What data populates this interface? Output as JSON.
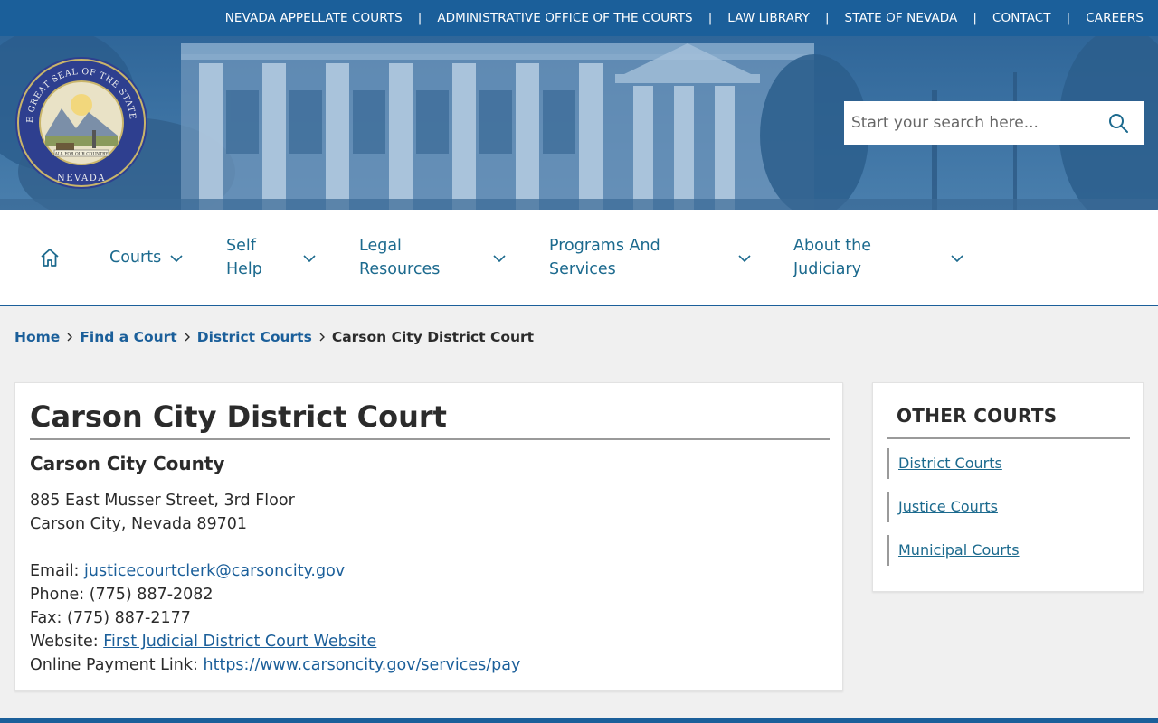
{
  "top_links": [
    {
      "label": "NEVADA APPELLATE COURTS"
    },
    {
      "label": "ADMINISTRATIVE OFFICE OF THE COURTS"
    },
    {
      "label": "LAW LIBRARY"
    },
    {
      "label": "STATE OF NEVADA"
    },
    {
      "label": "CONTACT"
    },
    {
      "label": "CAREERS"
    }
  ],
  "top_separator": "|",
  "seal": {
    "ring_text": "THE GREAT SEAL OF THE STATE OF",
    "bottom_text": "NEVADA",
    "motto": "ALL FOR OUR COUNTRY",
    "icon": "state-seal"
  },
  "search": {
    "placeholder": "Start your search here...",
    "icon": "search-icon"
  },
  "nav": {
    "home_icon": "home-icon",
    "items": [
      {
        "label": "Courts"
      },
      {
        "line1": "Self",
        "line2": "Help"
      },
      {
        "line1": "Legal",
        "line2": "Resources"
      },
      {
        "line1": "Programs And",
        "line2": "Services"
      },
      {
        "line1": "About the",
        "line2": "Judiciary"
      }
    ]
  },
  "breadcrumb": {
    "links": [
      "Home",
      "Find a Court",
      "District Courts"
    ],
    "current": "Carson City District Court"
  },
  "court": {
    "title": "Carson City District Court",
    "county": "Carson City County",
    "address_line1": "885 East Musser Street, 3rd Floor",
    "address_line2": "Carson City, Nevada 89701",
    "email_label": "Email:",
    "email": "justicecourtclerk@carsoncity.gov",
    "phone_label": "Phone:",
    "phone": "(775) 887-2082",
    "fax_label": "Fax:",
    "fax": "(775) 887-2177",
    "website_label": "Website:",
    "website": "First Judicial District Court Website",
    "payment_label": "Online Payment Link:",
    "payment": "https://www.carsoncity.gov/services/pay"
  },
  "sidebar": {
    "title": "OTHER COURTS",
    "links": [
      "District Courts",
      "Justice Courts",
      "Municipal Courts"
    ]
  },
  "colors": {
    "primary_blue": "#1b5f9a",
    "nav_teal": "#1c6a8e",
    "background": "#f0f0f0"
  }
}
